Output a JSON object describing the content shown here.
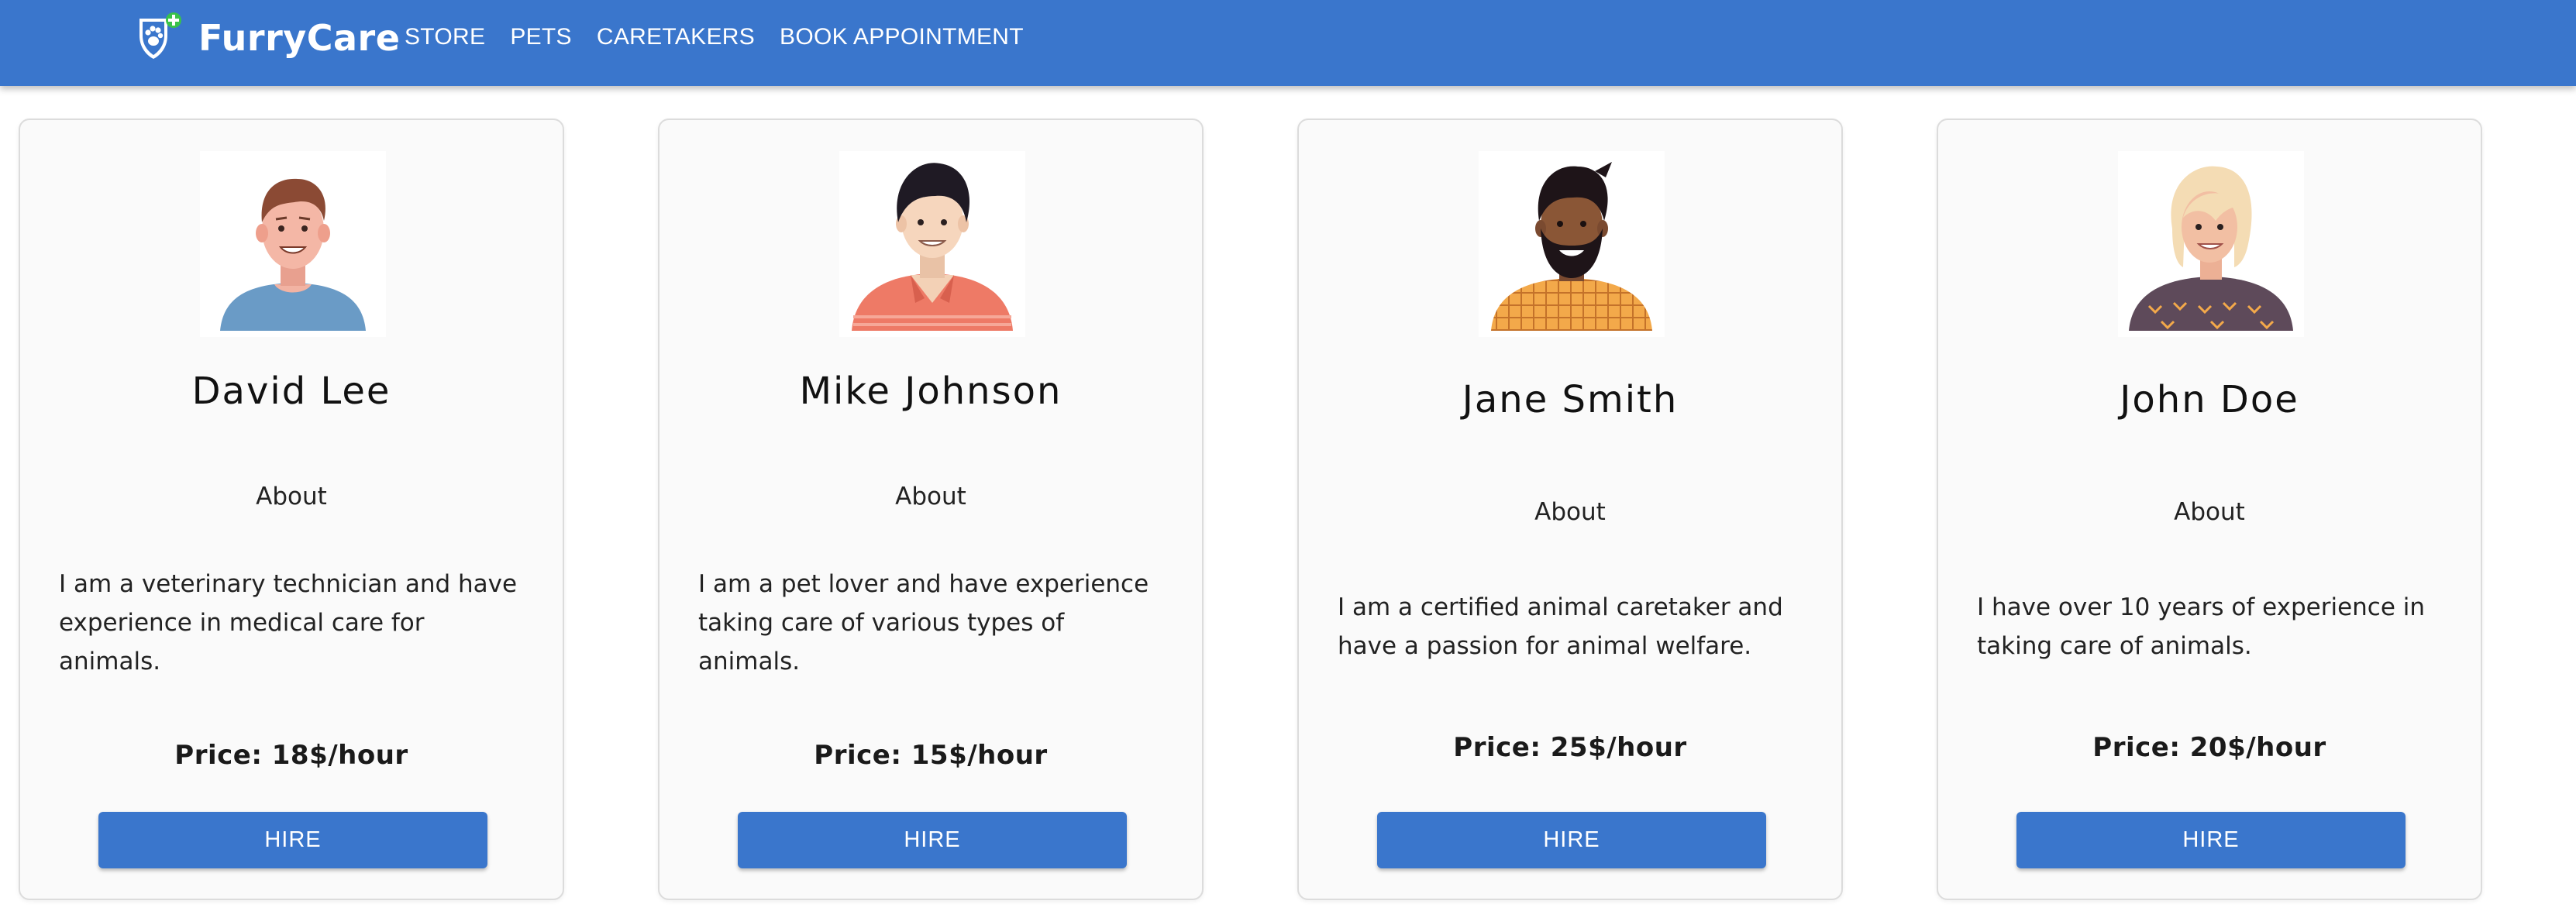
{
  "header": {
    "brand": "FurryCare",
    "nav": [
      "STORE",
      "PETS",
      "CARETAKERS",
      "BOOK APPOINTMENT"
    ]
  },
  "colors": {
    "primary": "#3a76cc",
    "card_bg": "#fafafa"
  },
  "caretakers": [
    {
      "name": "David Lee",
      "about_title": "About",
      "about": "I am a veterinary technician and have experience in medical care for animals.",
      "price": "Price: 18$/hour",
      "hire_label": "HIRE",
      "avatar": "man-blue-shirt-avatar"
    },
    {
      "name": "Mike Johnson",
      "about_title": "About",
      "about": "I am a pet lover and have experience taking care of various types of animals.",
      "price": "Price: 15$/hour",
      "hire_label": "HIRE",
      "avatar": "man-coral-polo-avatar"
    },
    {
      "name": "Jane Smith",
      "about_title": "About",
      "about": "I am a certified animal caretaker and have a passion for animal welfare.",
      "price": "Price: 25$/hour",
      "hire_label": "HIRE",
      "avatar": "bearded-man-plaid-shirt-avatar"
    },
    {
      "name": "John Doe",
      "about_title": "About",
      "about": "I have over 10 years of experience in taking care of animals.",
      "price": "Price: 20$/hour",
      "hire_label": "HIRE",
      "avatar": "blonde-woman-sweater-avatar"
    }
  ]
}
